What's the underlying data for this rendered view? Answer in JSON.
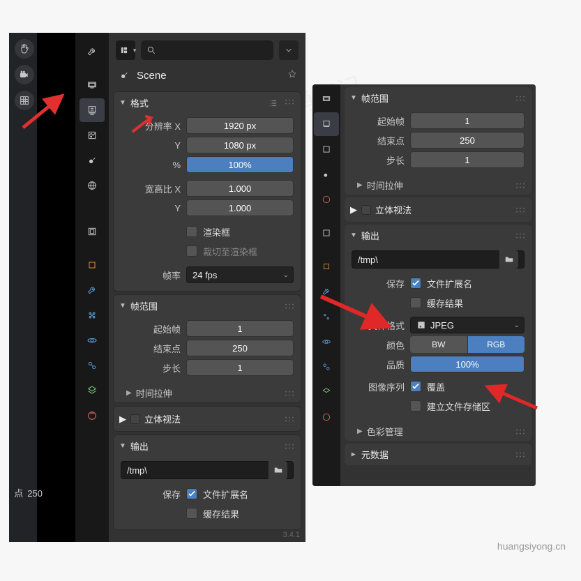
{
  "scene_title": "Scene",
  "viewport": {
    "end_label_prefix": "点",
    "end_label_value": "250"
  },
  "format": {
    "title": "格式",
    "res_label": "分辨率 X",
    "res_y_label": "Y",
    "res_x": "1920 px",
    "res_y": "1080 px",
    "pct_label": "%",
    "pct": "100%",
    "aspect_label": "宽高比 X",
    "aspect_y_label": "Y",
    "asp_x": "1.000",
    "asp_y": "1.000",
    "render_region": "渲染框",
    "crop_region": "裁切至渲染框",
    "fps_label": "帧率",
    "fps": "24 fps"
  },
  "frame_range": {
    "title": "帧范围",
    "start_label": "起始帧",
    "start": "1",
    "end_label": "结束点",
    "end": "250",
    "step_label": "步长",
    "step": "1",
    "time_stretch": "时间拉伸"
  },
  "stereo": {
    "title": "立体视法"
  },
  "output": {
    "title": "输出",
    "path": "/tmp\\",
    "save_label": "保存",
    "file_ext": "文件扩展名",
    "cache_result": "缓存结果",
    "file_fmt_label": "文件格式",
    "file_fmt": "JPEG",
    "color_label": "颜色",
    "bw": "BW",
    "rgb": "RGB",
    "quality_label": "品质",
    "quality": "100%",
    "img_seq_label": "图像序列",
    "overwrite": "覆盖",
    "placeholders": "建立文件存储区"
  },
  "color_mgmt": {
    "title": "色彩管理"
  },
  "metadata": {
    "title": "元数据"
  },
  "watermark": "黄思勇笔记",
  "site": "huangsiyong.cn"
}
